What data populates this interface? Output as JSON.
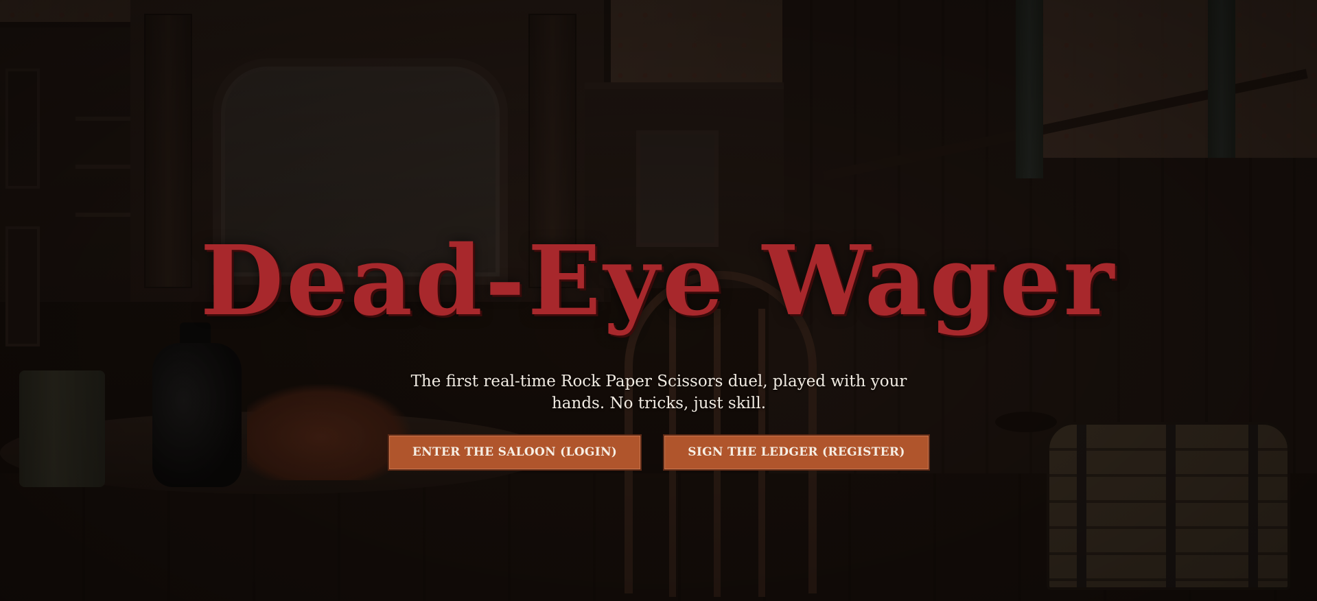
{
  "hero": {
    "title": "Dead-Eye Wager",
    "tagline": "The first real-time Rock Paper Scissors duel, played with your hands. No tricks, just skill.",
    "login_label": "ENTER THE SALOON (LOGIN)",
    "register_label": "SIGN THE LEDGER (REGISTER)"
  },
  "colors": {
    "title": "#a8282c",
    "button_bg": "#b0552c",
    "button_text": "#f6eee4",
    "tagline": "#f1ebe2"
  }
}
